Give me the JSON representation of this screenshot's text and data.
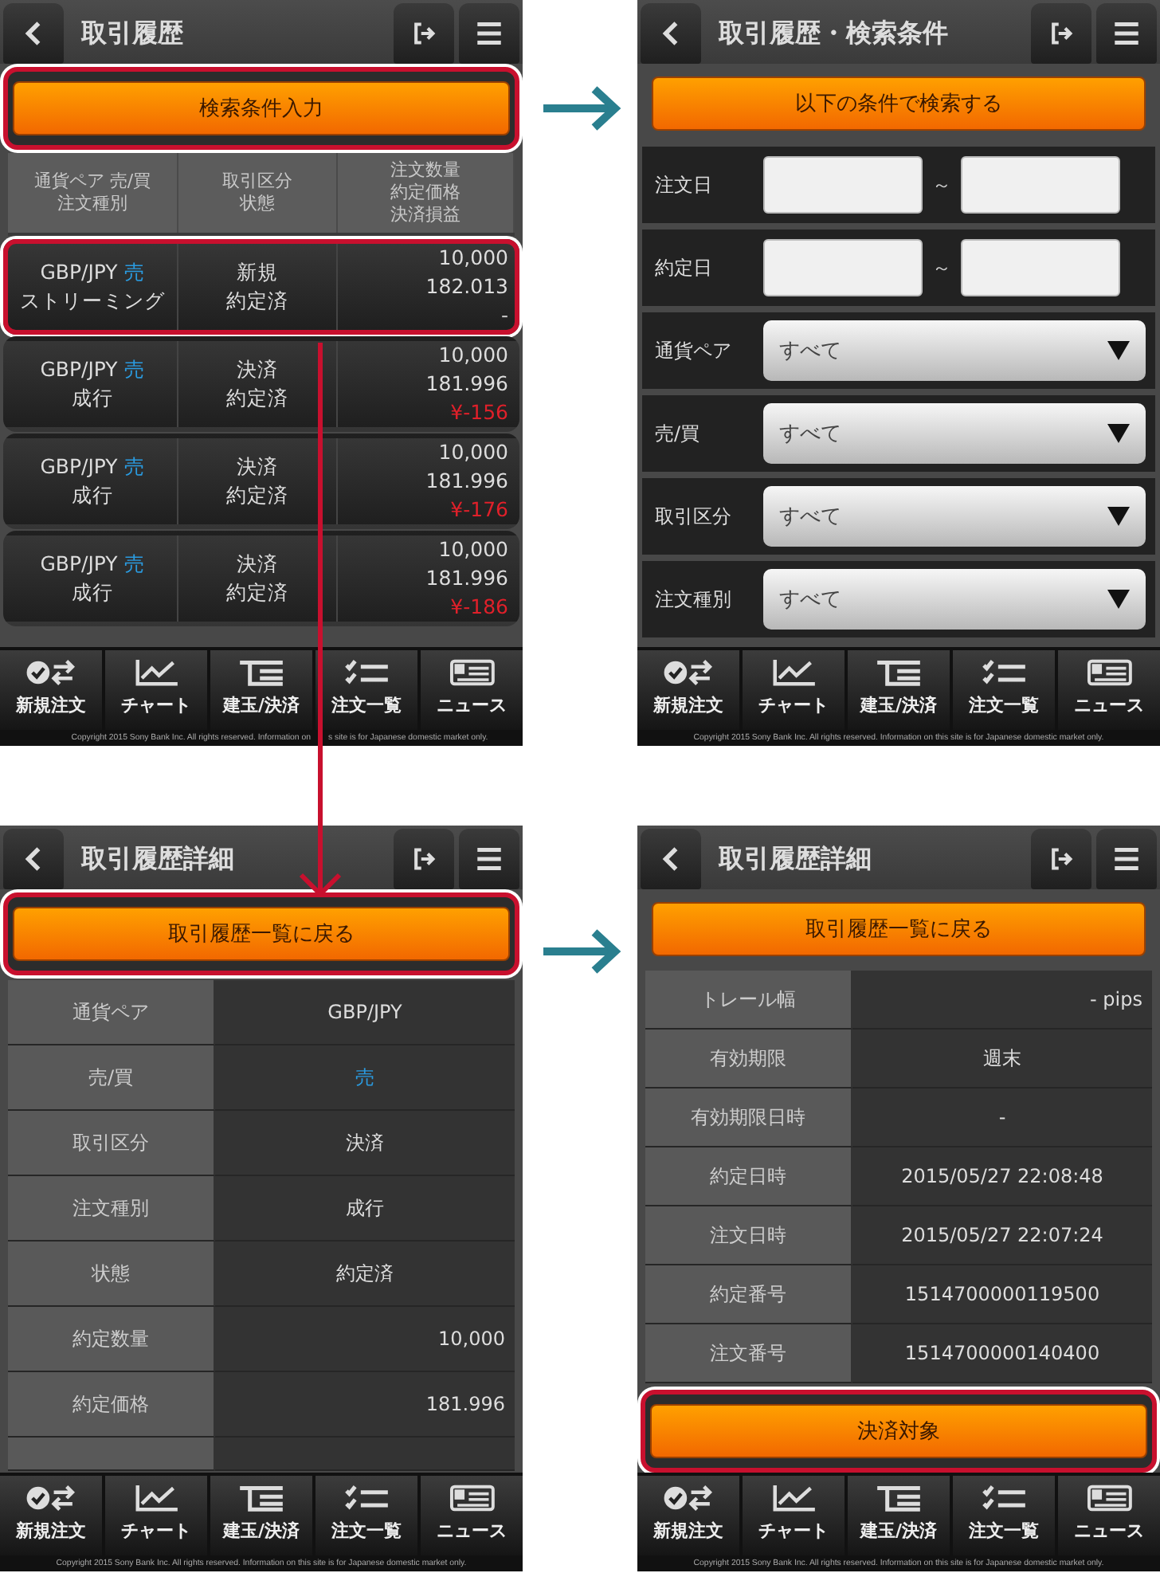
{
  "screens": [
    {
      "kind": "history_list",
      "title": "取引履歴",
      "primary_button": {
        "label": "検索条件入力",
        "highlighted": true
      },
      "columns": [
        {
          "lines": [
            "通貨ペア 売/買",
            "注文種別"
          ]
        },
        {
          "lines": [
            "取引区分",
            "状態"
          ]
        },
        {
          "lines": [
            "注文数量",
            "約定価格",
            "決済損益"
          ]
        }
      ],
      "rows": [
        {
          "pair": "GBP/JPY",
          "side": "売",
          "order_type": "ストリーミング",
          "trade_type": "新規",
          "status": "約定済",
          "quantity": "10,000",
          "price": "182.013",
          "pnl": "-",
          "pnl_negative": false,
          "highlighted": true
        },
        {
          "pair": "GBP/JPY",
          "side": "売",
          "order_type": "成行",
          "trade_type": "決済",
          "status": "約定済",
          "quantity": "10,000",
          "price": "181.996",
          "pnl": "¥-156",
          "pnl_negative": true,
          "highlighted": false
        },
        {
          "pair": "GBP/JPY",
          "side": "売",
          "order_type": "成行",
          "trade_type": "決済",
          "status": "約定済",
          "quantity": "10,000",
          "price": "181.996",
          "pnl": "¥-176",
          "pnl_negative": true,
          "highlighted": false
        },
        {
          "pair": "GBP/JPY",
          "side": "売",
          "order_type": "成行",
          "trade_type": "決済",
          "status": "約定済",
          "quantity": "10,000",
          "price": "181.996",
          "pnl": "¥-186",
          "pnl_negative": true,
          "highlighted": false
        }
      ],
      "nav": [
        "新規注文",
        "チャート",
        "建玉/決済",
        "注文一覧",
        "ニュース"
      ],
      "copyright": [
        "Copyright 2015 Sony Bank Inc. All rights reserved. Information on",
        "s site is for Japanese domestic market only."
      ]
    },
    {
      "kind": "search_form",
      "title": "取引履歴・検索条件",
      "primary_button": {
        "label": "以下の条件で検索する",
        "highlighted": false
      },
      "fields": [
        {
          "kind": "date_range",
          "label": "注文日",
          "separator": "～"
        },
        {
          "kind": "date_range",
          "label": "約定日",
          "separator": "～"
        },
        {
          "kind": "select",
          "label": "通貨ペア",
          "value": "すべて"
        },
        {
          "kind": "select",
          "label": "売/買",
          "value": "すべて"
        },
        {
          "kind": "select",
          "label": "取引区分",
          "value": "すべて"
        },
        {
          "kind": "select",
          "label": "注文種別",
          "value": "すべて"
        }
      ],
      "nav": [
        "新規注文",
        "チャート",
        "建玉/決済",
        "注文一覧",
        "ニュース"
      ],
      "copyright": "Copyright 2015 Sony Bank Inc. All rights reserved. Information on this site is for Japanese domestic market only."
    },
    {
      "kind": "detail",
      "title": "取引履歴詳細",
      "primary_button": {
        "label": "取引履歴一覧に戻る",
        "highlighted": true
      },
      "rows": [
        {
          "label": "通貨ペア",
          "value": "GBP/JPY",
          "kind": "text"
        },
        {
          "label": "売/買",
          "value": "売",
          "kind": "side"
        },
        {
          "label": "取引区分",
          "value": "決済",
          "kind": "text"
        },
        {
          "label": "注文種別",
          "value": "成行",
          "kind": "text"
        },
        {
          "label": "状態",
          "value": "約定済",
          "kind": "text"
        },
        {
          "label": "約定数量",
          "value": "10,000",
          "kind": "number"
        },
        {
          "label": "約定価格",
          "value": "181.996",
          "kind": "number"
        }
      ],
      "nav": [
        "新規注文",
        "チャート",
        "建玉/決済",
        "注文一覧",
        "ニュース"
      ],
      "copyright": "Copyright 2015 Sony Bank Inc. All rights reserved. Information on this site is for Japanese domestic market only."
    },
    {
      "kind": "detail",
      "title": "取引履歴詳細",
      "primary_button": {
        "label": "取引履歴一覧に戻る",
        "highlighted": false
      },
      "rows": [
        {
          "label": "トレール幅",
          "value": "- pips",
          "kind": "number"
        },
        {
          "label": "有効期限",
          "value": "週末",
          "kind": "text"
        },
        {
          "label": "有効期限日時",
          "value": "-",
          "kind": "text"
        },
        {
          "label": "約定日時",
          "value": "2015/05/27 22:08:48",
          "kind": "text"
        },
        {
          "label": "注文日時",
          "value": "2015/05/27 22:07:24",
          "kind": "text"
        },
        {
          "label": "約定番号",
          "value": "1514700000119500",
          "kind": "text"
        },
        {
          "label": "注文番号",
          "value": "1514700000140400",
          "kind": "text"
        }
      ],
      "action_button": {
        "label": "決済対象",
        "highlighted": true
      },
      "nav": [
        "新規注文",
        "チャート",
        "建玉/決済",
        "注文一覧",
        "ニュース"
      ],
      "copyright": "Copyright 2015 Sony Bank Inc. All rights reserved. Information on this site is for Japanese domestic market only."
    }
  ]
}
